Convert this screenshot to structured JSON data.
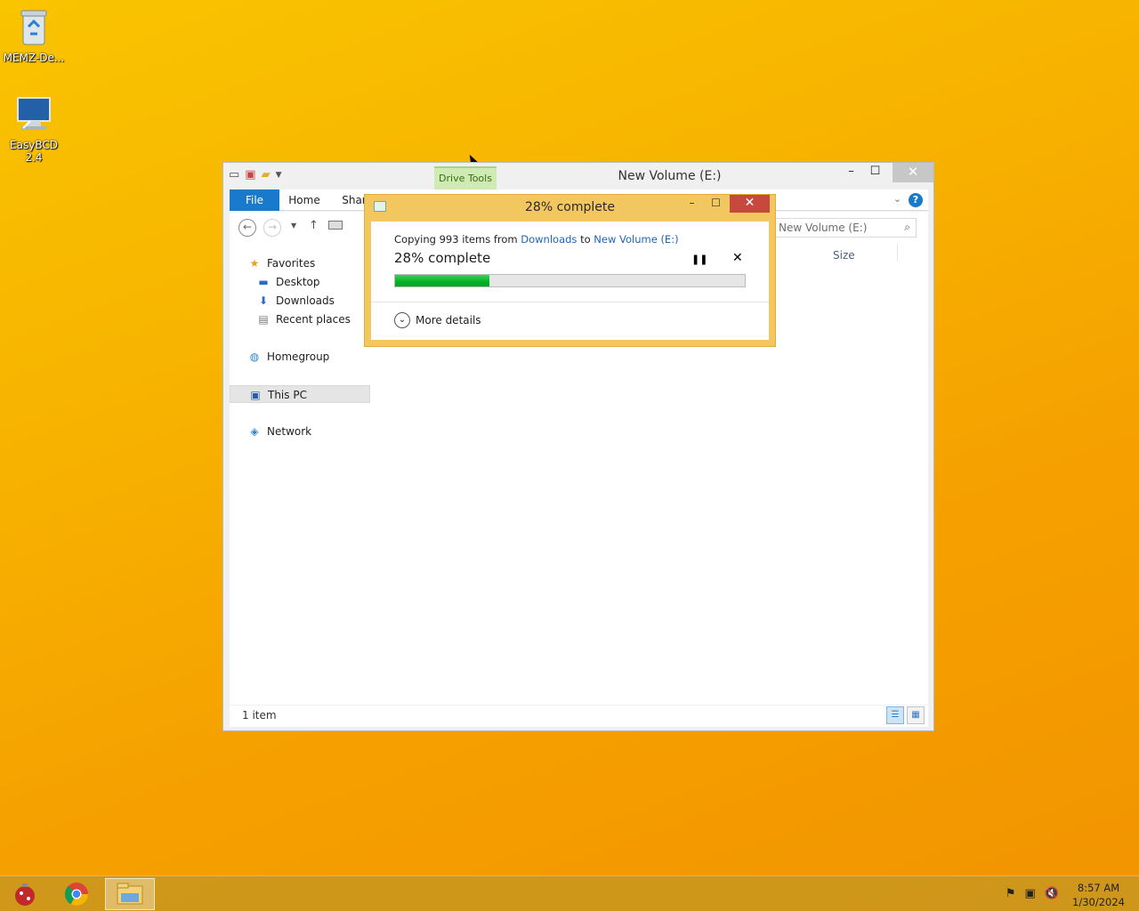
{
  "desktop": {
    "icons": [
      {
        "label": "MEMZ-De...",
        "icon": "recycle-bin-icon"
      },
      {
        "label": "EasyBCD 2.4",
        "icon": "easybcd-icon"
      }
    ]
  },
  "explorer": {
    "title": "New Volume (E:)",
    "contextual_tab": "Drive Tools",
    "tabs": [
      "File",
      "Home",
      "Shar"
    ],
    "search_placeholder": "New Volume (E:)",
    "column_size": "Size",
    "nav": {
      "favorites": "Favorites",
      "desktop": "Desktop",
      "downloads": "Downloads",
      "recent": "Recent places",
      "homegroup": "Homegroup",
      "thispc": "This PC",
      "network": "Network"
    },
    "status": "1 item",
    "window_buttons": {
      "minimize": "–",
      "maximize": "☐",
      "close": "✕"
    }
  },
  "copy_dialog": {
    "title": "28% complete",
    "line_prefix": "Copying 993 items from",
    "source": "Downloads",
    "line_mid": "to",
    "destination": "New Volume (E:)",
    "percent_text": "28% complete",
    "progress": 0.27,
    "more_details": "More details",
    "pause_glyph": "❚❚",
    "cancel_glyph": "✕"
  },
  "taskbar": {
    "time": "8:57 AM",
    "date": "1/30/2024",
    "pinned": [
      "memz-icon",
      "chrome-icon",
      "file-explorer-icon"
    ]
  },
  "colors": {
    "accent": "#1979ca",
    "progress": "#06b025",
    "dialog_frame": "#f3c75f",
    "close_red": "#c7483d"
  }
}
